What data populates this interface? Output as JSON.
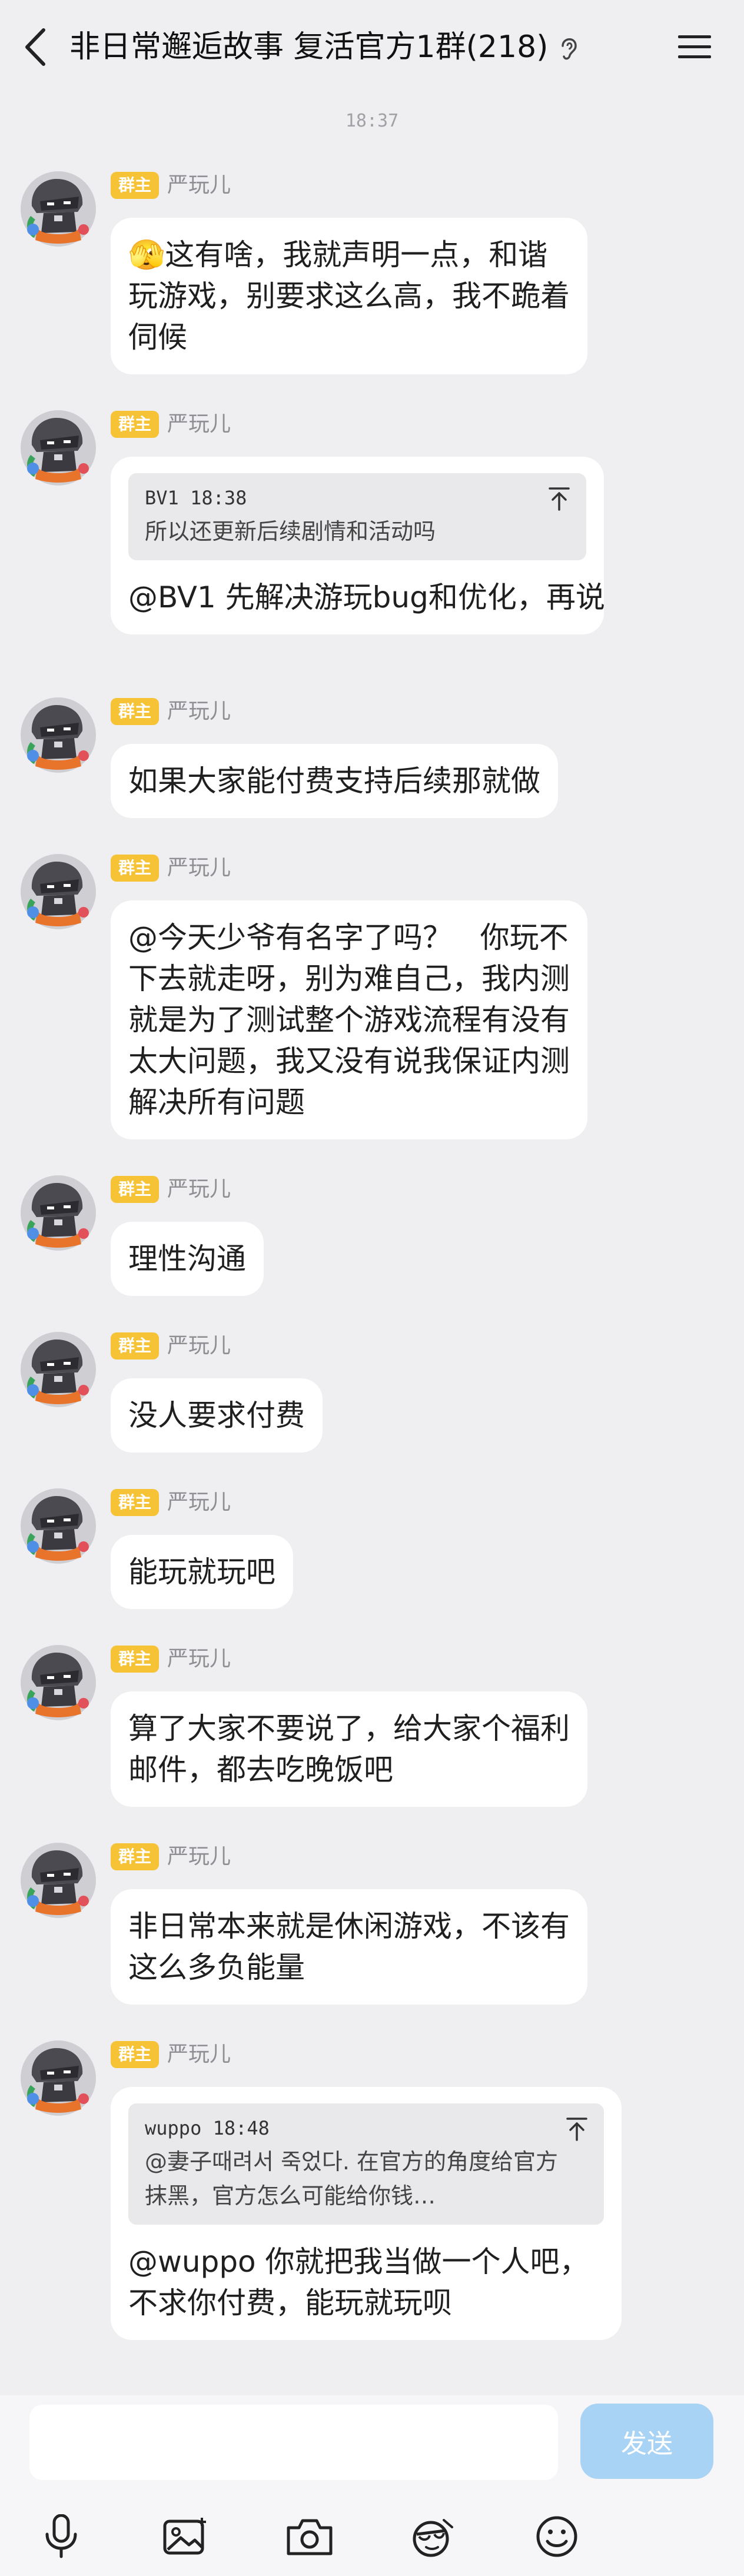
{
  "header": {
    "title": "非日常邂逅故事 复活官方1群(218)",
    "back_icon": "chevron-left-icon",
    "ear_icon": "ear-icon",
    "menu_icon": "hamburger-menu-icon"
  },
  "timestamp": "18:37",
  "messages": [
    {
      "badge": "群主",
      "sender": "严玩儿",
      "lines": [
        "🫣这有啥，我就声明一点，和谐",
        "玩游戏，别要求这么高，我不跪着",
        "伺候"
      ]
    },
    {
      "badge": "群主",
      "sender": "严玩儿",
      "quote": {
        "meta": "BV1 18:38",
        "text": "所以还更新后续剧情和活动吗"
      },
      "lines": [
        "@BV1 先解决游玩bug和优化，再说"
      ]
    },
    {
      "badge": "群主",
      "sender": "严玩儿",
      "lines": [
        "如果大家能付费支持后续那就做"
      ]
    },
    {
      "badge": "群主",
      "sender": "严玩儿",
      "lines": [
        "@今天少爷有名字了吗？   你玩不",
        "下去就走呀，别为难自己，我内测",
        "就是为了测试整个游戏流程有没有",
        "太大问题，我又没有说我保证内测",
        "解决所有问题"
      ]
    },
    {
      "badge": "群主",
      "sender": "严玩儿",
      "lines": [
        "理性沟通"
      ]
    },
    {
      "badge": "群主",
      "sender": "严玩儿",
      "lines": [
        "没人要求付费"
      ]
    },
    {
      "badge": "群主",
      "sender": "严玩儿",
      "lines": [
        "能玩就玩吧"
      ]
    },
    {
      "badge": "群主",
      "sender": "严玩儿",
      "lines": [
        "算了大家不要说了，给大家个福利",
        "邮件，都去吃晚饭吧"
      ]
    },
    {
      "badge": "群主",
      "sender": "严玩儿",
      "lines": [
        "非日常本来就是休闲游戏，不该有",
        "这么多负能量"
      ]
    },
    {
      "badge": "群主",
      "sender": "严玩儿",
      "quote": {
        "meta": "wuppo 18:48",
        "text": "@妻子때려서 죽었다. 在官方的角度给官方",
        "text2": "抹黑，官方怎么可能给你钱…"
      },
      "lines": [
        "@wuppo 你就把我当做一个人吧，",
        "不求你付费，能玩就玩呗"
      ]
    }
  ],
  "composer": {
    "input_value": "",
    "input_placeholder": "",
    "send_label": "发送"
  },
  "toolbar": [
    "microphone-icon",
    "image-icon",
    "camera-icon",
    "sticker-icon",
    "emoji-icon"
  ],
  "colors": {
    "background": "#efeff1",
    "badge": "#f6c236",
    "send_disabled": "#a8d3f4",
    "bubble": "#ffffff"
  }
}
